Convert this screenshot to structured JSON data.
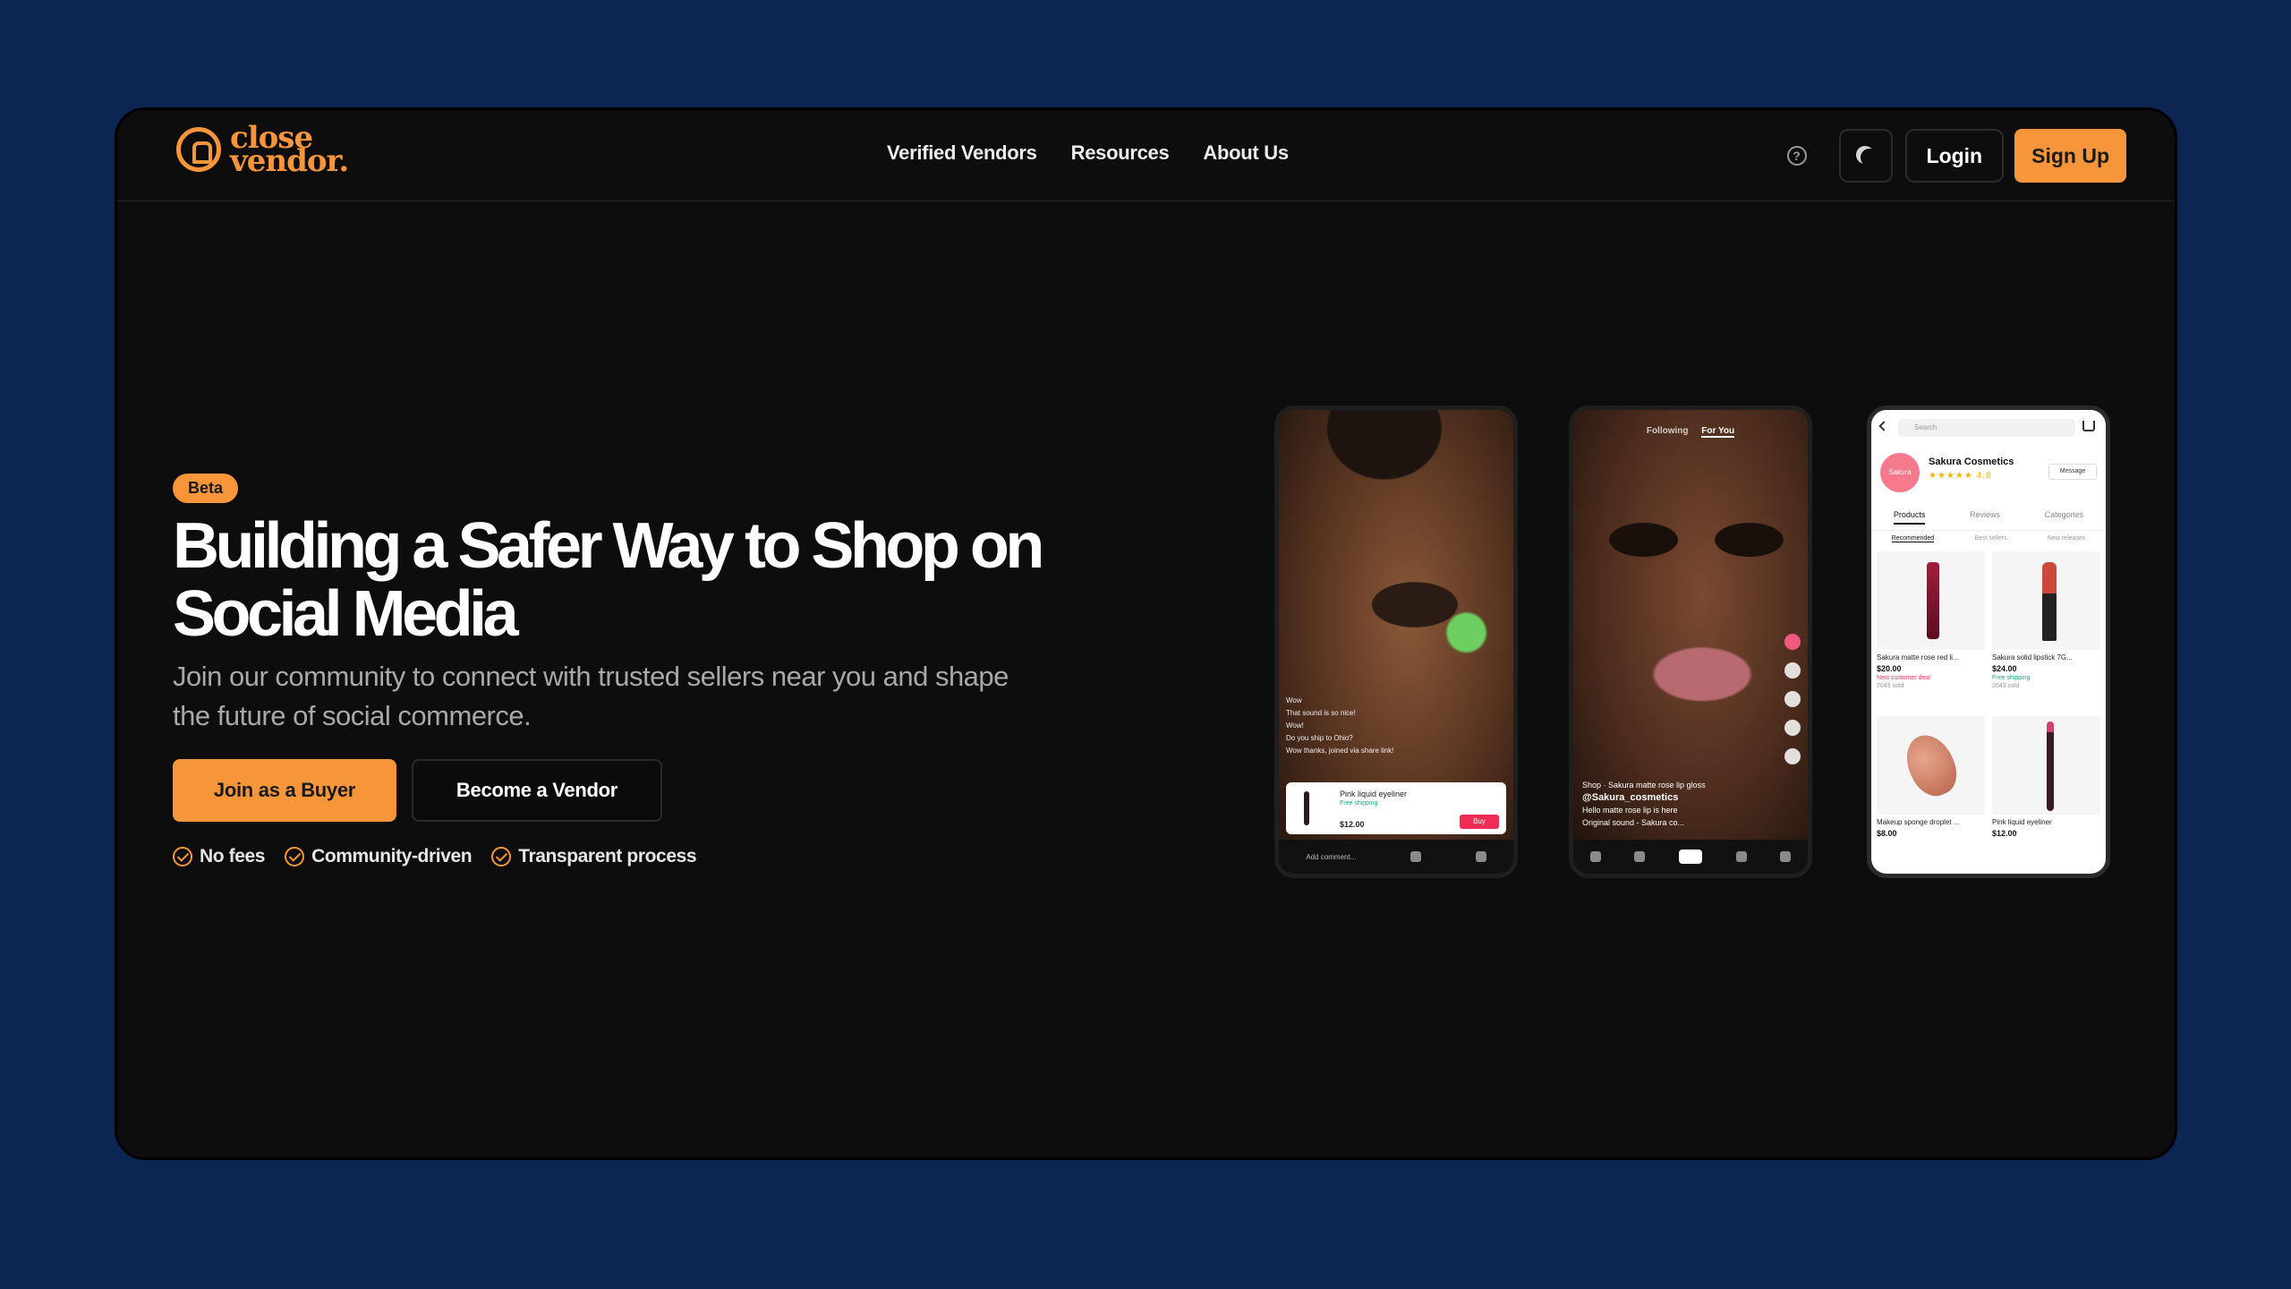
{
  "brand": {
    "line1": "close",
    "line2": "vendor.",
    "accent": "#f7953a"
  },
  "nav": {
    "items": [
      "Verified Vendors",
      "Resources",
      "About Us"
    ]
  },
  "header": {
    "help_icon": "help-circle-icon",
    "theme_icon": "moon-icon",
    "login": "Login",
    "signup": "Sign Up"
  },
  "hero": {
    "badge": "Beta",
    "title": "Building a Safer Way to Shop on Social Media",
    "subtitle": "Join our community to connect with trusted sellers near you and shape the future of social commerce.",
    "cta_primary": "Join as a Buyer",
    "cta_secondary": "Become a Vendor",
    "features": [
      "No fees",
      "Community-driven",
      "Transparent process"
    ]
  },
  "phones": {
    "live": {
      "chat": [
        "Wow",
        "That sound is so nice!",
        "Wow!",
        "Do you ship to Ohio?",
        "Wow thanks, joined via share link!"
      ],
      "product_title": "Pink liquid eyeliner",
      "product_ship": "Free shipping",
      "product_price": "$12.00",
      "buy_label": "Buy",
      "comment_placeholder": "Add comment..."
    },
    "feed": {
      "tabs": [
        "Following",
        "For You"
      ],
      "product_line": "Shop · Sakura matte rose lip gloss",
      "handle": "@Sakura_cosmetics",
      "desc": "Hello matte rose lip is here",
      "sound": "Original sound - Sakura co..."
    },
    "shop": {
      "search_placeholder": "Search",
      "avatar_label": "Sakura",
      "name": "Sakura Cosmetics",
      "stars": "★★★★★ 4.8",
      "message_label": "Message",
      "tabs": [
        "Products",
        "Reviews",
        "Categories"
      ],
      "subtabs": [
        "Recommended",
        "Best sellers",
        "New releases"
      ],
      "products": [
        {
          "name": "Sakura matte rose red li...",
          "price": "$20.00",
          "tag": "New customer deal",
          "sold": "2043 sold"
        },
        {
          "name": "Sakura solid lipstick 7G...",
          "price": "$24.00",
          "tag": "Free shipping",
          "sold": "2043 sold"
        },
        {
          "name": "Makeup sponge droplet ...",
          "price": "$8.00",
          "tag": "",
          "sold": ""
        },
        {
          "name": "Pink liquid eyeliner",
          "price": "$12.00",
          "tag": "",
          "sold": ""
        }
      ]
    }
  }
}
